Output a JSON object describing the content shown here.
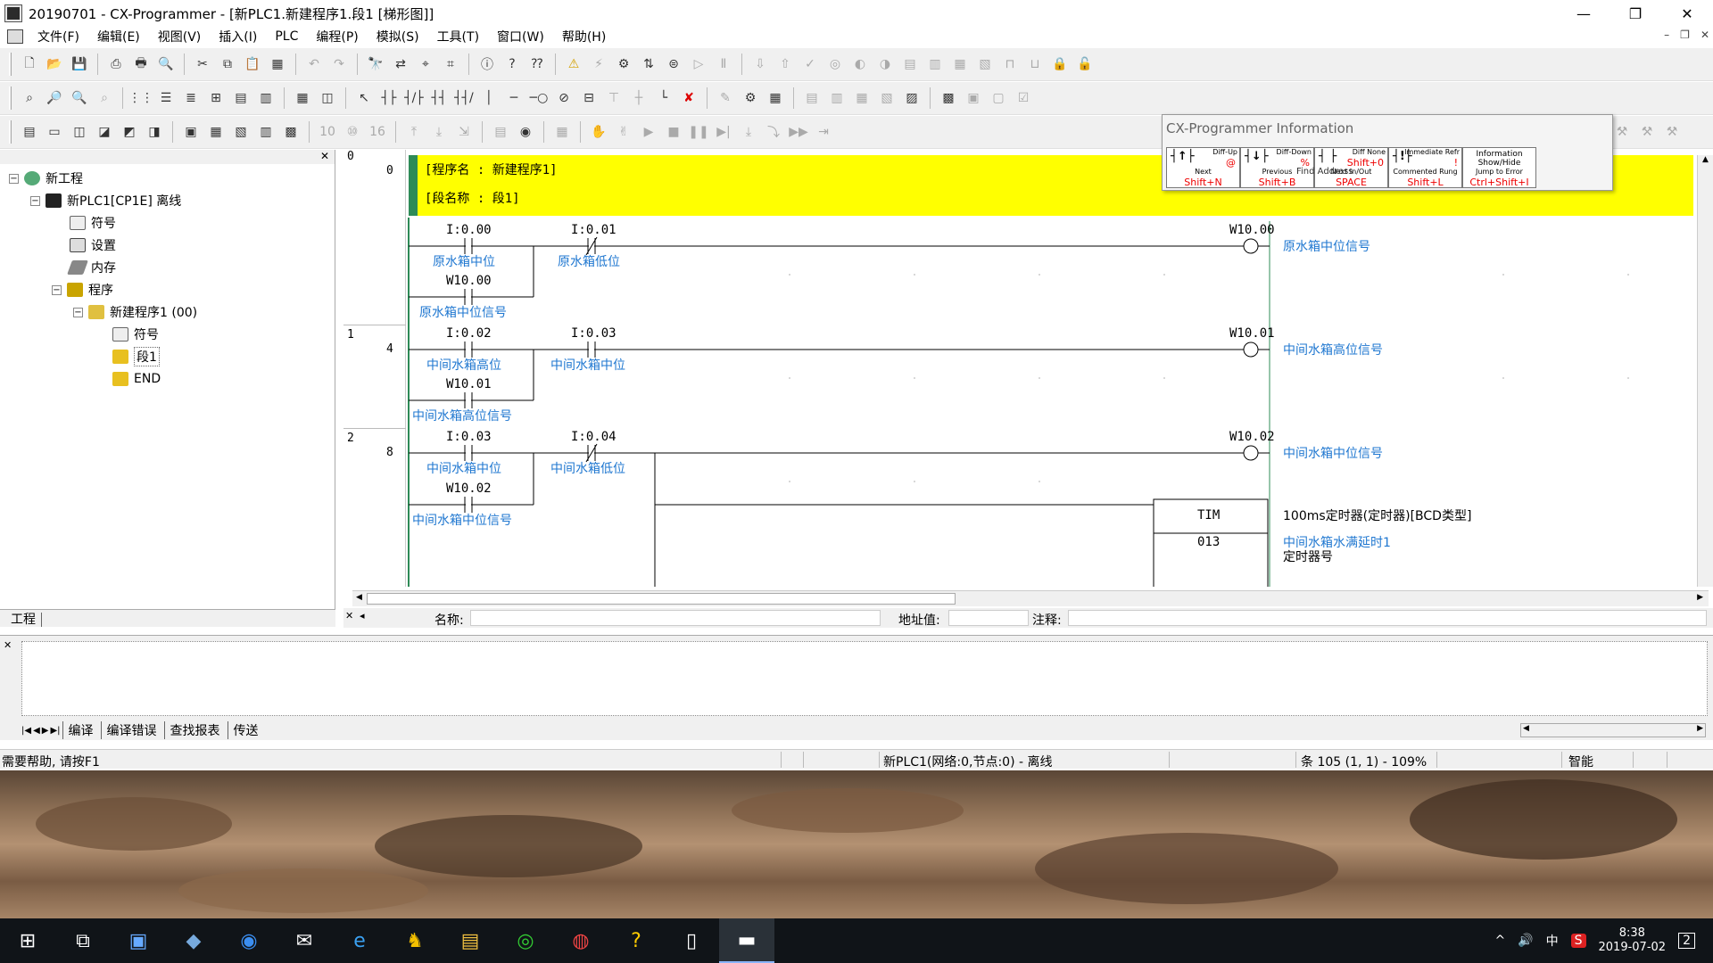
{
  "window": {
    "title": "20190701 - CX-Programmer - [新PLC1.新建程序1.段1 [梯形图]]",
    "minimize": "—",
    "maximize": "❐",
    "close": "✕"
  },
  "menu": {
    "items": [
      "文件(F)",
      "编辑(E)",
      "视图(V)",
      "插入(I)",
      "PLC",
      "编程(P)",
      "模拟(S)",
      "工具(T)",
      "窗口(W)",
      "帮助(H)"
    ],
    "mdi_min": "–",
    "mdi_restore": "❐",
    "mdi_close": "✕"
  },
  "tree": {
    "close": "✕",
    "nodes": [
      {
        "label": "新工程",
        "icon": "project-icon"
      },
      {
        "label": "新PLC1[CP1E] 离线",
        "icon": "plc-icon"
      },
      {
        "label": "符号",
        "icon": "symbols-icon"
      },
      {
        "label": "设置",
        "icon": "settings-icon"
      },
      {
        "label": "内存",
        "icon": "memory-icon"
      },
      {
        "label": "程序",
        "icon": "programs-icon"
      },
      {
        "label": "新建程序1 (00)",
        "icon": "program-icon"
      },
      {
        "label": "符号",
        "icon": "symbols-icon"
      },
      {
        "label": "段1",
        "icon": "section-icon"
      },
      {
        "label": "END",
        "icon": "section-icon"
      }
    ],
    "tab": "工程"
  },
  "ladder": {
    "header": {
      "program_name": "[程序名 :  新建程序1]",
      "section_name": "[段名称 :  段1]"
    },
    "rungs": [
      {
        "rung": "0",
        "step": "0"
      },
      {
        "rung": "1",
        "step": "4"
      },
      {
        "rung": "2",
        "step": "8"
      }
    ],
    "header_rung": "0",
    "r0": {
      "c1_addr": "I:0.00",
      "c1_cmt": "原水箱中位",
      "c2_addr": "I:0.01",
      "c2_cmt": "原水箱低位",
      "p_addr": "W10.00",
      "p_cmt": "原水箱中位信号",
      "coil_addr": "W10.00",
      "coil_cmt": "原水箱中位信号"
    },
    "r1": {
      "c1_addr": "I:0.02",
      "c1_cmt": "中间水箱高位",
      "c2_addr": "I:0.03",
      "c2_cmt": "中间水箱中位",
      "p_addr": "W10.01",
      "p_cmt": "中间水箱高位信号",
      "coil_addr": "W10.01",
      "coil_cmt": "中间水箱高位信号"
    },
    "r2": {
      "c1_addr": "I:0.03",
      "c1_cmt": "中间水箱中位",
      "c2_addr": "I:0.04",
      "c2_cmt": "中间水箱低位",
      "p_addr": "W10.02",
      "p_cmt": "中间水箱中位信号",
      "coil_addr": "W10.02",
      "coil_cmt": "中间水箱中位信号",
      "tim_label": "TIM",
      "tim_num": "013",
      "tim_desc": "100ms定时器(定时器)[BCD类型]",
      "tim_cmt": "中间水箱水满延时1",
      "tim_sub": "定时器号"
    }
  },
  "info_popup": {
    "title": "CX-Programmer Information",
    "cells": [
      {
        "sym": "┤↑├",
        "lbl": "Diff-Up",
        "key": "@",
        "lbl2": "Next",
        "key2": "Shift+N"
      },
      {
        "sym": "┤↓├",
        "lbl": "Diff-Down",
        "key": "%",
        "lbl2": "Previous",
        "key2": "Shift+B"
      },
      {
        "sym": "┤ ├",
        "lbl": "Diff None",
        "key": "Shift+0",
        "lbl2": "Next In/Out",
        "key2": "SPACE"
      },
      {
        "sym": "┤!├",
        "lbl": "Immediate Refr",
        "key": "!",
        "lbl2": "Commented Rung",
        "key2": "Shift+L"
      },
      {
        "sym": "",
        "lbl": "Information Show/Hide",
        "key": "",
        "lbl2": "Jump to Error",
        "key2": "Ctrl+Shift+I"
      }
    ],
    "find_address": "Find Address"
  },
  "namebar": {
    "name_label": "名称:",
    "address_label": "地址值:",
    "comment_label": "注释:"
  },
  "output": {
    "tabs": [
      "编译",
      "编译错误",
      "查找报表",
      "传送"
    ]
  },
  "status": {
    "help": "需要帮助, 请按F1",
    "plc": "新PLC1(网络:0,节点:0) - 离线",
    "rung": "条 105 (1, 1)  - 109%",
    "mode": "智能"
  },
  "taskbar": {
    "apps": [
      {
        "name": "start-icon",
        "glyph": "⊞"
      },
      {
        "name": "task-view-icon",
        "glyph": "⧉"
      },
      {
        "name": "computer-icon",
        "glyph": "▣"
      },
      {
        "name": "store-icon",
        "glyph": "◆"
      },
      {
        "name": "browser-icon",
        "glyph": "◉"
      },
      {
        "name": "mail-icon",
        "glyph": "✉"
      },
      {
        "name": "ie-icon",
        "glyph": "e"
      },
      {
        "name": "qq-icon",
        "glyph": "♞"
      },
      {
        "name": "folder-icon",
        "glyph": "▤"
      },
      {
        "name": "wechat-icon",
        "glyph": "◎"
      },
      {
        "name": "chrome-icon",
        "glyph": "◍"
      },
      {
        "name": "help-app-icon",
        "glyph": "?"
      },
      {
        "name": "notepad-icon",
        "glyph": "▯"
      },
      {
        "name": "cx-programmer-icon",
        "glyph": "▬"
      }
    ],
    "tray": {
      "chevron": "^",
      "volume": "🔊",
      "ime": "中",
      "antivirus": "S",
      "time": "8:38",
      "date": "2019-07-02",
      "notify": "2"
    }
  },
  "colors": {
    "header_band": "#ffff00",
    "comment_blue": "#1f77d0",
    "rail_green": "#2e8b57"
  }
}
